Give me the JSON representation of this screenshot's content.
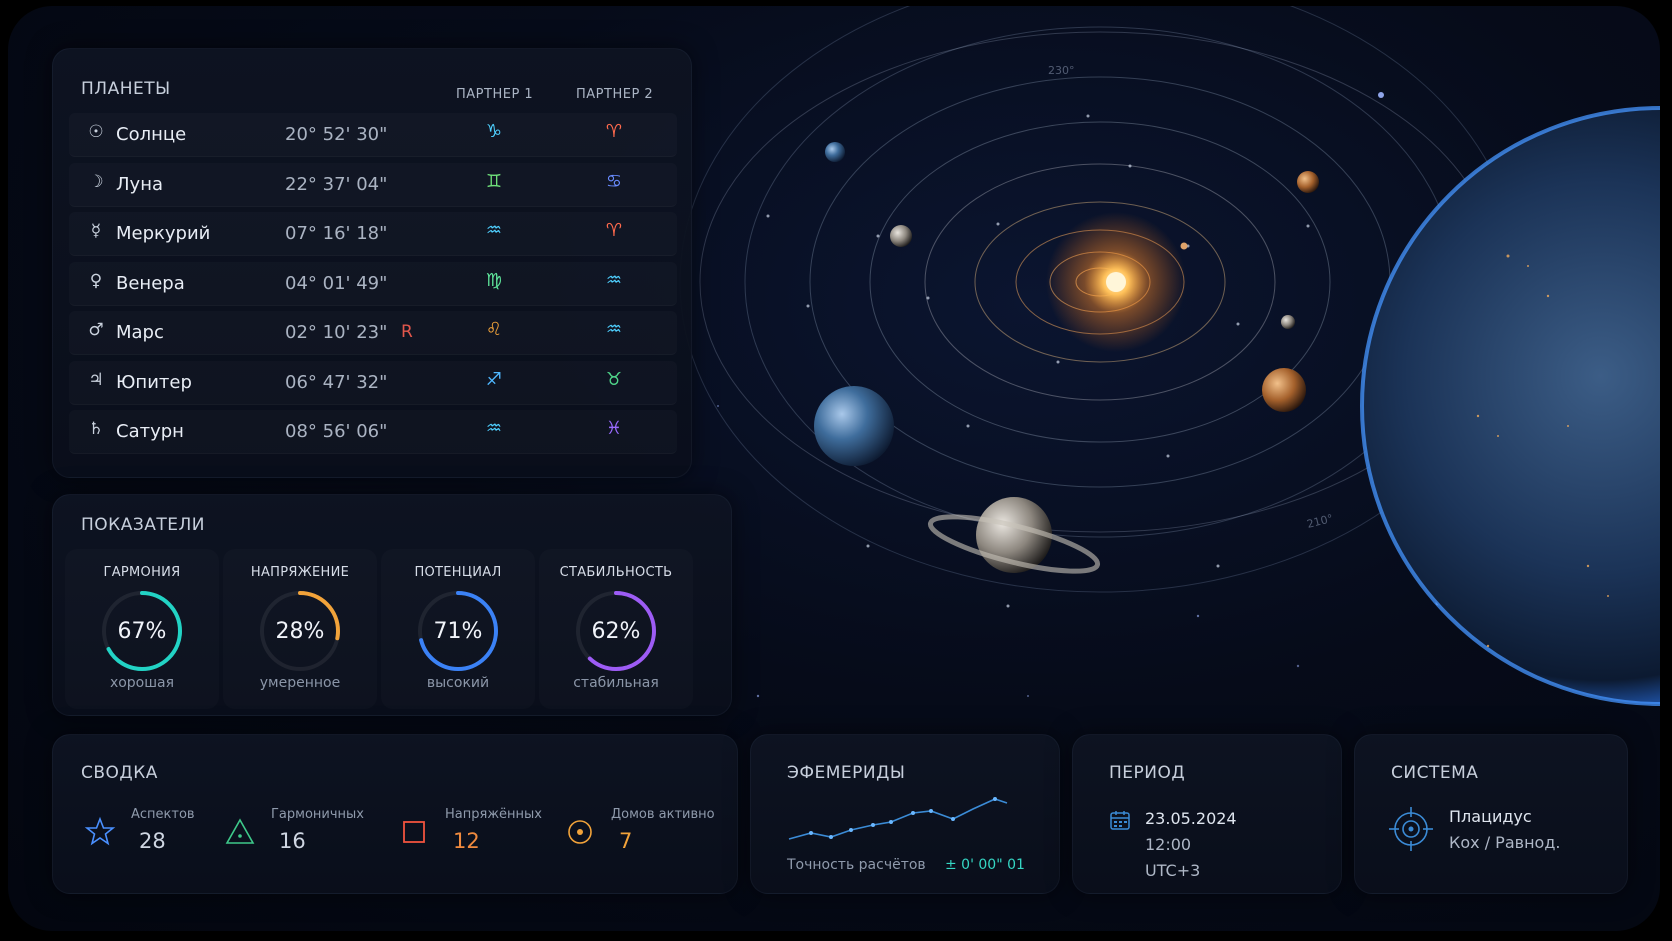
{
  "planets_panel": {
    "title": "ПЛАНЕТЫ",
    "col_partner1": "ПАРТНЕР 1",
    "col_partner2": "ПАРТНЕР 2",
    "rows": [
      {
        "glyph": "☉",
        "name": "Солнце",
        "position": "20° 52' 30\"",
        "retro": "",
        "sign1": "♑",
        "sign2": "♈",
        "sign2_color": "#ff6a4d"
      },
      {
        "glyph": "☽",
        "name": "Луна",
        "position": "22° 37' 04\"",
        "retro": "",
        "sign1": "♊",
        "sign2": "♋",
        "sign2_color": "#6a8cff"
      },
      {
        "glyph": "☿",
        "name": "Меркурий",
        "position": "07° 16' 18\"",
        "retro": "",
        "sign1": "♒",
        "sign2": "♈",
        "sign2_color": "#ff6a4d"
      },
      {
        "glyph": "♀",
        "name": "Венера",
        "position": "04° 01' 49\"",
        "retro": "",
        "sign1": "♍",
        "sign2": "♒",
        "sign2_color": "#4fd0ff"
      },
      {
        "glyph": "♂",
        "name": "Марс",
        "position": "02° 10' 23\"",
        "retro": "R",
        "sign1": "♌",
        "sign2": "♒",
        "sign2_color": "#4fd0ff"
      },
      {
        "glyph": "♃",
        "name": "Юпитер",
        "position": "06° 47' 32\"",
        "retro": "",
        "sign1": "♐",
        "sign2": "♉",
        "sign2_color": "#4fd68a"
      },
      {
        "glyph": "♄",
        "name": "Сатурн",
        "position": "08° 56' 06\"",
        "retro": "",
        "sign1": "♒",
        "sign2": "♓",
        "sign2_color": "#9a6bff"
      }
    ],
    "sign1_colors": [
      "#4fd0ff",
      "#6fe07a",
      "#4fd0ff",
      "#5ee39a",
      "#f2a33a",
      "#4fb7ff",
      "#4fd0ff"
    ]
  },
  "indicators": {
    "title": "ПОКАЗАТЕЛИ",
    "items": [
      {
        "label": "ГАРМОНИЯ",
        "value": "67%",
        "fraction": 0.67,
        "status": "хорошая",
        "color": "#22d3c5"
      },
      {
        "label": "НАПРЯЖЕНИЕ",
        "value": "28%",
        "fraction": 0.28,
        "status": "умеренное",
        "color": "#f2a33a"
      },
      {
        "label": "ПОТЕНЦИАЛ",
        "value": "71%",
        "fraction": 0.71,
        "status": "высокий",
        "color": "#3b82f6"
      },
      {
        "label": "СТАБИЛЬНОСТЬ",
        "value": "62%",
        "fraction": 0.62,
        "status": "стабильная",
        "color": "#9d5cf5"
      }
    ]
  },
  "summary": {
    "title": "СВОДКА",
    "items": [
      {
        "label": "Аспектов",
        "value": "28",
        "icon": "star-icon",
        "color": "#4a90ff",
        "value_color": "#cfd6e2"
      },
      {
        "label": "Гармоничных",
        "value": "16",
        "icon": "triangle-icon",
        "color": "#3ec98a",
        "value_color": "#cfd6e2"
      },
      {
        "label": "Напряжённых",
        "value": "12",
        "icon": "square-icon",
        "color": "#f0533e",
        "value_color": "#f08a3e"
      },
      {
        "label": "Домов активно",
        "value": "7",
        "icon": "target-icon",
        "color": "#f2a33a",
        "value_color": "#f2a33a"
      }
    ]
  },
  "ephemeris": {
    "title": "ЭФЕМЕРИДЫ",
    "accuracy_label": "Точность расчётов",
    "accuracy_value": "± 0' 00\" 01"
  },
  "period": {
    "title": "ПЕРИОД",
    "date": "23.05.2024",
    "time": "12:00",
    "timezone": "UTC+3"
  },
  "system": {
    "title": "СИСТЕМА",
    "name": "Плацидус",
    "sub": "Кох / Равнод."
  },
  "orbit_labels": [
    "230°",
    "210°"
  ],
  "colors": {
    "accent_cyan": "#4fd0ff",
    "accent_teal": "#35d6c4",
    "sun": "#ffb04a",
    "earth": "#2f7cff"
  }
}
